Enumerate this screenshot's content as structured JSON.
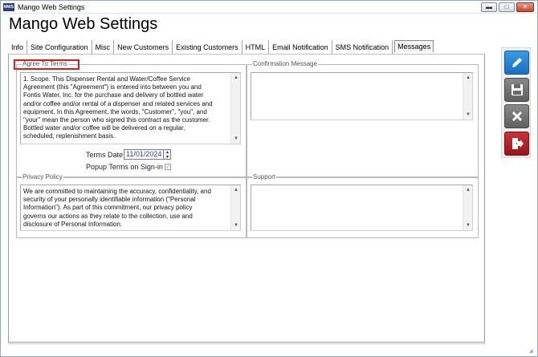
{
  "window": {
    "app_icon_label": "MWS",
    "title": "Mango Web Settings",
    "minimize_symbol": "▬",
    "maximize_symbol": "□",
    "close_symbol": "✕"
  },
  "page_title": "Mango Web Settings",
  "tabs": [
    {
      "label": "Info"
    },
    {
      "label": "Site Configuration"
    },
    {
      "label": "Misc"
    },
    {
      "label": "New Customers"
    },
    {
      "label": "Existing Customers"
    },
    {
      "label": "HTML"
    },
    {
      "label": "Email Notification"
    },
    {
      "label": "SMS Notification"
    },
    {
      "label": "Messages",
      "active": true
    }
  ],
  "agree_to_terms": {
    "label": "Agree To Terms",
    "text": "1. Scope.  This Dispenser Rental and Water/Coffee Service\nAgreement (this \"Agreement\") is entered into between you and\nFontis Water, Inc. for the purchase and delivery of bottled water\nand/or coffee and/or rental of a dispenser and related services and\nequipment.  In this Agreement, the words, \"Customer\", \"you\", and\n\"your\" mean the person who signed this contract as the customer.\nBottled water and/or coffee will be delivered on a regular,\nscheduled, replenishment basis."
  },
  "confirmation_message": {
    "label": "Confirmation Message",
    "text": ""
  },
  "terms_date": {
    "label": "Terms Date",
    "value": "11/01/2024"
  },
  "popup_terms": {
    "label": "Popup Terms on Sign-in",
    "checked": true,
    "check_symbol": "✓"
  },
  "privacy_policy": {
    "label": "Privacy Policy",
    "text": "We are committed to maintaining the accuracy, confidentiality, and\nsecurity of your personally identifiable information (\"Personal\nInformation\"). As part of this commitment, our privacy policy\ngoverns our actions as they relate to the collection, use and\ndisclosure of Personal Information."
  },
  "support": {
    "label": "Support",
    "text": ""
  },
  "toolbar": {
    "edit_icon": "pencil-icon",
    "save_icon": "floppy-disk-icon",
    "cancel_icon": "x-icon",
    "exit_icon": "exit-door-icon"
  },
  "colors": {
    "highlight": "#e01b1b",
    "edit_button": "#1f7ad0",
    "exit_button": "#b2232a",
    "date_text": "#2a3bd1"
  }
}
